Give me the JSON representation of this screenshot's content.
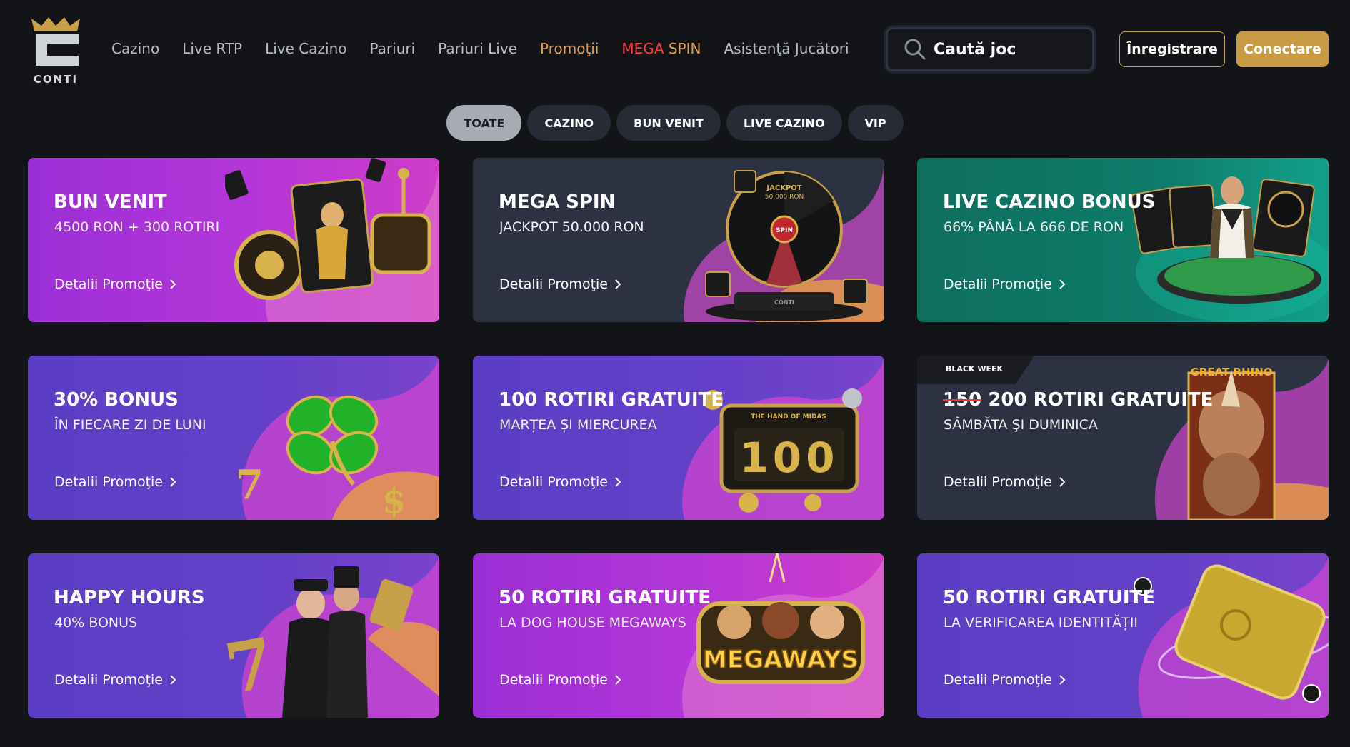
{
  "header": {
    "logo_text": "CONTI",
    "nav": [
      {
        "label": "Cazino"
      },
      {
        "label": "Live RTP"
      },
      {
        "label": "Live Cazino"
      },
      {
        "label": "Pariuri"
      },
      {
        "label": "Pariuri Live"
      },
      {
        "label": "Promoţii"
      },
      {
        "label_a": "MEGA",
        "label_b": "SPIN"
      },
      {
        "label": "Asistenţă Jucători"
      }
    ],
    "search": {
      "placeholder": "Caută joc"
    },
    "register_label": "Înregistrare",
    "login_label": "Conectare"
  },
  "filters": [
    {
      "label": "TOATE",
      "active": true
    },
    {
      "label": "CAZINO",
      "active": false
    },
    {
      "label": "BUN VENIT",
      "active": false
    },
    {
      "label": "LIVE CAZINO",
      "active": false
    },
    {
      "label": "VIP",
      "active": false
    }
  ],
  "cards": [
    {
      "title": "BUN VENIT",
      "subtitle": "4500 RON + 300 ROTIRI",
      "details": "Detalii Promoţie",
      "art_icon": "slot-machine-card-icon"
    },
    {
      "title": "MEGA SPIN",
      "subtitle": "JACKPOT 50.000 RON",
      "details": "Detalii Promoţie",
      "art_icon": "prize-wheel-icon",
      "art_text": [
        "JACKPOT",
        "50.000 RON",
        "SPIN",
        "CONTI"
      ]
    },
    {
      "title": "LIVE CAZINO BONUS",
      "subtitle": "66% PÂNĂ LA 666 DE RON",
      "details": "Detalii Promoţie",
      "art_icon": "live-dealer-table-icon"
    },
    {
      "title": "30% BONUS",
      "subtitle": "ÎN FIECARE ZI DE LUNI",
      "details": "Detalii Promoţie",
      "art_icon": "four-leaf-clover-icon"
    },
    {
      "title": "100 ROTIRI GRATUITE",
      "subtitle": "MARȚEA ȘI MIERCUREA",
      "details": "Detalii Promoţie",
      "art_icon": "slot-reels-100-icon",
      "art_text": [
        "THE HAND OF MIDAS",
        "100"
      ]
    },
    {
      "badge": "BLACK WEEK",
      "title_struck": "150",
      "title": "200 ROTIRI GRATUITE",
      "subtitle": "SÂMBĂTA ŞI DUMINICA",
      "details": "Detalii Promoţie",
      "art_icon": "rhino-icon",
      "art_text": [
        "GREAT RHINO"
      ]
    },
    {
      "title": "HAPPY HOURS",
      "subtitle": "40% BONUS",
      "details": "Detalii Promoţie",
      "art_icon": "steampunk-couple-icon"
    },
    {
      "title": "50 ROTIRI GRATUITE",
      "subtitle": "LA DOG HOUSE MEGAWAYS",
      "details": "Detalii Promoţie",
      "art_icon": "dog-house-reel-icon",
      "art_text": [
        "MEGAWAYS"
      ]
    },
    {
      "title": "50 ROTIRI GRATUITE",
      "subtitle": "LA VERIFICAREA IDENTITĂȚII",
      "details": "Detalii Promoţie",
      "art_icon": "gold-id-card-icon"
    }
  ],
  "colors": {
    "background": "#131417",
    "accent_gold": "#c99a44",
    "promo_orange": "#e0a050",
    "mega_red": "#ff3b3b",
    "card_magenta": "#b536d8",
    "card_slate": "#2c3242",
    "card_green": "#0e7c6a",
    "card_violet": "#6440c8"
  }
}
